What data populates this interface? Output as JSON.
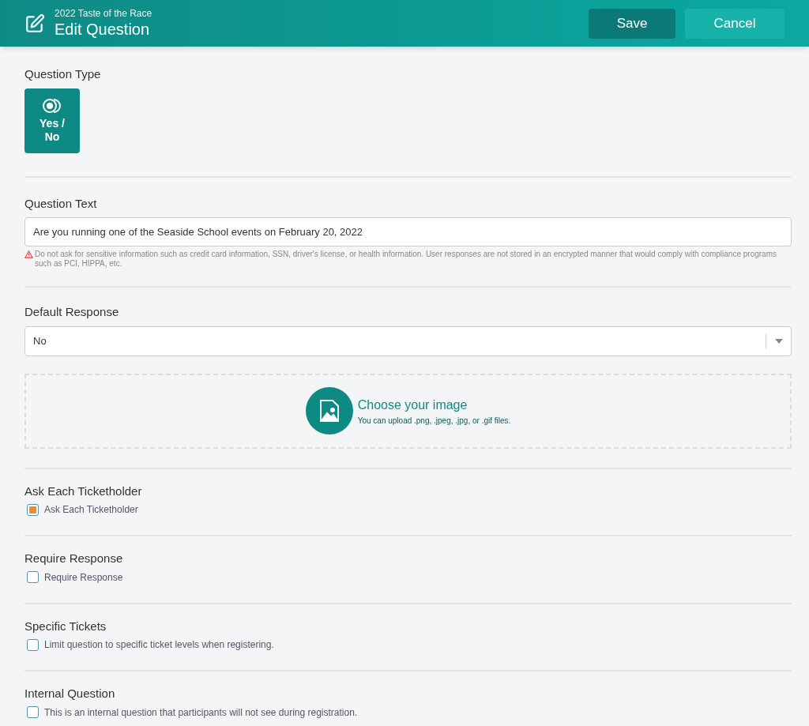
{
  "header": {
    "subtitle": "2022 Taste of the Race",
    "title": "Edit Question",
    "buttons": [
      {
        "label": "Save",
        "kind": "primary"
      },
      {
        "label": "Cancel",
        "kind": "secondary"
      }
    ]
  },
  "question_type": {
    "label": "Question Type",
    "types": [
      {
        "label": "Yes / No",
        "selected": true
      }
    ]
  },
  "question_text": {
    "label": "Question Text",
    "value": "Are you running one of the Seaside School events on February 20, 2022",
    "warning": "Do not ask for sensitive information such as credit card information, SSN, driver's license, or health information. User responses are not stored in an encrypted manner that would comply with compliance programs such as PCI, HIPPA, etc."
  },
  "default_response": {
    "label": "Default Response",
    "value": "No"
  },
  "image_upload": {
    "title": "Choose your image",
    "hint": "You can upload .png, .jpeg, .jpg, or .gif files."
  },
  "options": [
    {
      "heading": "Ask Each Ticketholder",
      "label": "Ask Each Ticketholder",
      "checked": true
    },
    {
      "heading": "Require Response",
      "label": "Require Response",
      "checked": false
    },
    {
      "heading": "Specific Tickets",
      "label": "Limit question to specific ticket levels when registering.",
      "checked": false
    },
    {
      "heading": "Internal Question",
      "label": "This is an internal question that participants will not see during registration.",
      "checked": false
    }
  ]
}
